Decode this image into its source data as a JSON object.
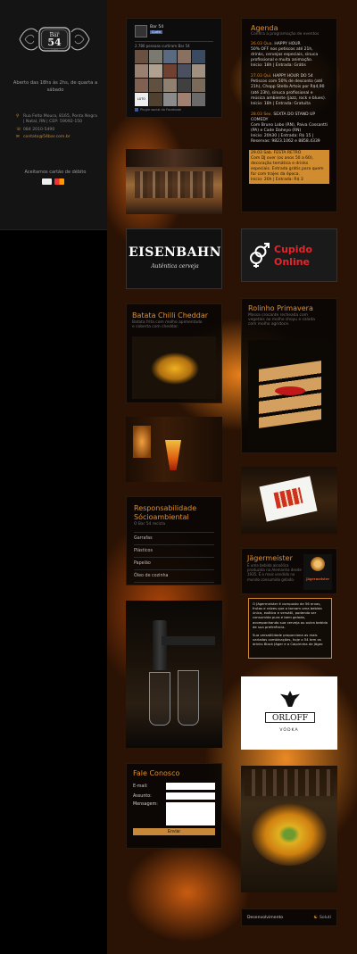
{
  "brand": {
    "logo_top": "cerveja",
    "logo_main": "Bar",
    "logo_number": "54",
    "logo_bottom": "natal"
  },
  "sidebar": {
    "hours": "Aberto das 18hs às 2hs, de quarta a sábado",
    "address": "Rua Felto Moura, 8165, Ponta Negra | Natal, RN | CEP: 59092-150",
    "phone": "084 2010-5490",
    "email": "contato@54bar.com.br",
    "cards_label": "Aceitamos cartão de débito"
  },
  "facebook": {
    "page_name": "Bar 54",
    "like_label": "Curtir",
    "fans_text": "2.780 pessoas curtiram Bar 54",
    "plugin_label": "Plugin social do Facebook",
    "badge": "LUTO"
  },
  "agenda": {
    "title": "Agenda",
    "subtitle": "Confira a programação de eventos",
    "events": [
      {
        "date": "26.03 Qua.",
        "name": "HAPPY HOUR",
        "desc": "50% OFF nos petiscos até 21h, drinks, cervejas especiais, sinuca profissional e muita animação.",
        "info": "Início: 18h | Entrada: Grátis",
        "highlight": false
      },
      {
        "date": "27.03 Qui.",
        "name": "HAPPY HOUR DO 54",
        "desc": "Petiscos com 50% de desconto (até 21h), Chopp Stella Artois por R$4,90 (até 23h), sinuca profissional e música ambiente (jazz, rock e blues).",
        "info": "Início: 18h | Entrada: Gratuita",
        "highlight": false
      },
      {
        "date": "28.03 Sex.",
        "name": "SEXTA DO STAND UP COMEDY",
        "desc": "Com Bruno Lobo (RN), Paiva Cossantti (PA) e Cade Daheyo (RN)",
        "info": "Início: 20h30 | Entrada: R$ 15 | Reservas: 9823.1062 e 8858.4339",
        "highlight": false
      },
      {
        "date": "29.03 Sab.",
        "name": "FESTA RETRÔ",
        "desc": "Com DJ over (os anos 50 a 60), decoração temática e drinks especiais. Entrada grátis para quem for com trajes da época.",
        "info": "Início: 20h | Entrada: R$ 3",
        "highlight": true
      }
    ]
  },
  "ads": {
    "eisenbahn_name": "EISENBAHN",
    "eisenbahn_tagline": "Autêntica cerveja",
    "cupido_line1": "Cupido",
    "cupido_line2": "Online",
    "orloff_name": "ORLOFF",
    "orloff_sub": "VÓDKA",
    "jager_logo": "Jägermeister"
  },
  "batata": {
    "title": "Batata Chilli Cheddar",
    "desc": "Batata frita com molho apimentado e coberta com cheddar."
  },
  "rolinho": {
    "title": "Rolinho Primavera",
    "desc": "Massa crocante recheada com vegetais ao molho shoyu e salada com molho agridoce."
  },
  "responsabilidade": {
    "title": "Responsabilidade Sócioambiental",
    "subtitle": "O Bar 54 recicla",
    "items": [
      "Garrafas",
      "Plásticos",
      "Papelão",
      "Óleo de cozinha"
    ]
  },
  "jager": {
    "title": "Jägermeister",
    "intro": "É uma bebida alcoólica produzida na Alemanha desde 1935. É o mais vendido no mundo consumido gelado.",
    "body1": "O Jägermeister é composto de 56 ervas, frutas e raízes que o tornam uma bebida única, exótica e versátil, podendo ser consumida pura e bem gelada, acompanhando sua cerveja ou outra bebida de sua preferência.",
    "body2": "Sua versatilidade proporciona as mais variadas combinações, hoje o 54 tem os drinks Black Jäger e a Caipirinha de Jäger."
  },
  "contact_form": {
    "title": "Fale Conosco",
    "email_label": "E-mail:",
    "subject_label": "Assunto:",
    "message_label": "Mensagem:",
    "submit_label": "Enviar"
  },
  "footer": {
    "left": "Desenvolvimento",
    "right": "Soluti"
  },
  "colors": {
    "accent": "#e0902a",
    "panel": "#0a0806",
    "highlight": "#d08c2e"
  }
}
